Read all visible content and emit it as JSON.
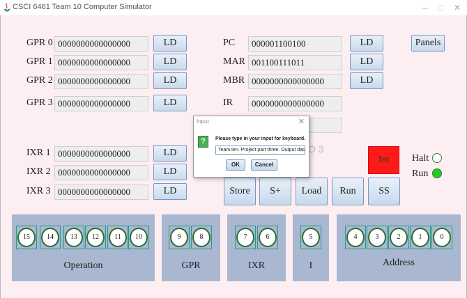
{
  "window": {
    "title": "CSCI 6461 Team 10 Computer Simulator"
  },
  "registers": {
    "gpr": [
      {
        "label": "GPR 0",
        "value": "0000000000000000",
        "button": "LD"
      },
      {
        "label": "GPR 1",
        "value": "0000000000000000",
        "button": "LD"
      },
      {
        "label": "GPR 2",
        "value": "0000000000000000",
        "button": "LD"
      },
      {
        "label": "GPR 3",
        "value": "0000000000000000",
        "button": "LD"
      }
    ],
    "ixr": [
      {
        "label": "IXR 1",
        "value": "0000000000000000",
        "button": "LD"
      },
      {
        "label": "IXR 2",
        "value": "0000000000000000",
        "button": "LD"
      },
      {
        "label": "IXR 3",
        "value": "0000000000000000",
        "button": "LD"
      }
    ],
    "pc": {
      "label": "PC",
      "value": "000001100100",
      "button": "LD"
    },
    "mar": {
      "label": "MAR",
      "value": "001100111011",
      "button": "LD"
    },
    "mbr": {
      "label": "MBR",
      "value": "0000000000000000",
      "button": "LD"
    },
    "ir": {
      "label": "IR",
      "value": "0000000000000000"
    }
  },
  "buttons": {
    "panels": "Panels",
    "store": "Store",
    "splus": "S+",
    "load": "Load",
    "run": "Run",
    "ss": "SS"
  },
  "indicators": {
    "int": "Int",
    "halt": "Halt",
    "run": "Run",
    "int_color": "#ff1a1a",
    "run_color": "#22cc22"
  },
  "obscured": {
    "ghost_text": "O 3"
  },
  "instruction_panels": [
    {
      "label": "Operation",
      "bits": [
        "15",
        "14",
        "13",
        "12",
        "11",
        "10"
      ]
    },
    {
      "label": "GPR",
      "bits": [
        "9",
        "8"
      ]
    },
    {
      "label": "IXR",
      "bits": [
        "7",
        "6"
      ]
    },
    {
      "label": "I",
      "bits": [
        "5"
      ]
    },
    {
      "label": "Address",
      "bits": [
        "4",
        "3",
        "2",
        "1",
        "0"
      ]
    }
  ],
  "dialog": {
    "title": "Input",
    "message": "Please type in your input for keyboard.",
    "input_value": "Team ten. Project part three. Output data.",
    "ok": "OK",
    "cancel": "Cancel"
  }
}
